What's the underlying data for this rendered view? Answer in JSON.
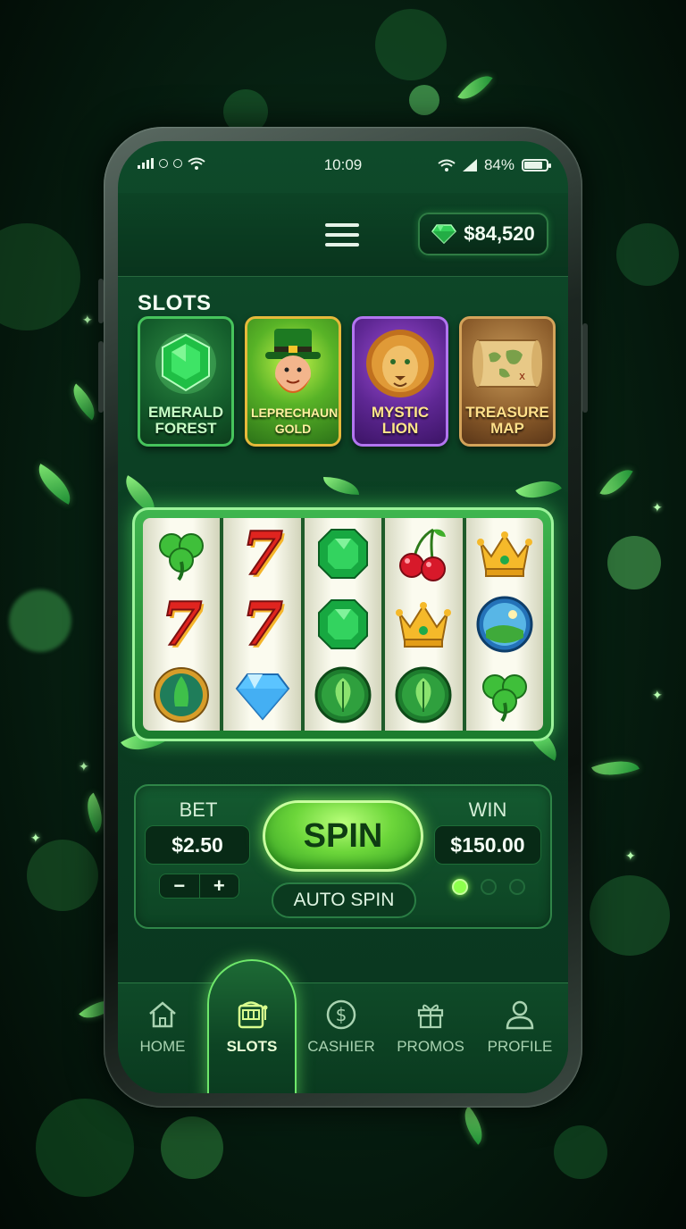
{
  "status_bar": {
    "time": "10:09",
    "battery": "84%",
    "battery_level": 0.84
  },
  "header": {
    "menu_icon": "hamburger-menu-icon",
    "balance_icon": "emerald-gem-icon",
    "balance": "$84,520"
  },
  "slots": {
    "title": "SLOTS",
    "games": [
      {
        "name": "EMERALD FOREST",
        "icon": "emerald-icon"
      },
      {
        "name": "LEPRECHAUN'S GOLD",
        "icon": "leprechaun-icon"
      },
      {
        "name": "MYSTIC LION",
        "icon": "lion-icon"
      },
      {
        "name": "TREASURE MAP",
        "icon": "map-icon"
      }
    ]
  },
  "reels": [
    [
      "clover",
      "seven",
      "forest-coin"
    ],
    [
      "seven",
      "seven",
      "diamond"
    ],
    [
      "emerald",
      "emerald",
      "leaf-coin"
    ],
    [
      "cherry",
      "crown",
      "leaf-coin"
    ],
    [
      "crown",
      "globe-coin",
      "clover"
    ]
  ],
  "controls": {
    "bet_label": "BET",
    "bet_value": "$2.50",
    "decrease": "−",
    "increase": "+",
    "spin_label": "SPIN",
    "auto_spin_label": "AUTO SPIN",
    "win_label": "WIN",
    "win_value": "$150.00",
    "active_dot": 0
  },
  "nav": {
    "items": [
      {
        "label": "HOME",
        "icon": "home-icon"
      },
      {
        "label": "SLOTS",
        "icon": "slot-machine-icon",
        "active": true
      },
      {
        "label": "CASHIER",
        "icon": "dollar-coin-icon"
      },
      {
        "label": "PROMOS",
        "icon": "gift-icon"
      },
      {
        "label": "PROFILE",
        "icon": "user-icon"
      }
    ]
  },
  "colors": {
    "accent": "#6cd63a",
    "background": "#072313",
    "panel": "#0d4424"
  }
}
